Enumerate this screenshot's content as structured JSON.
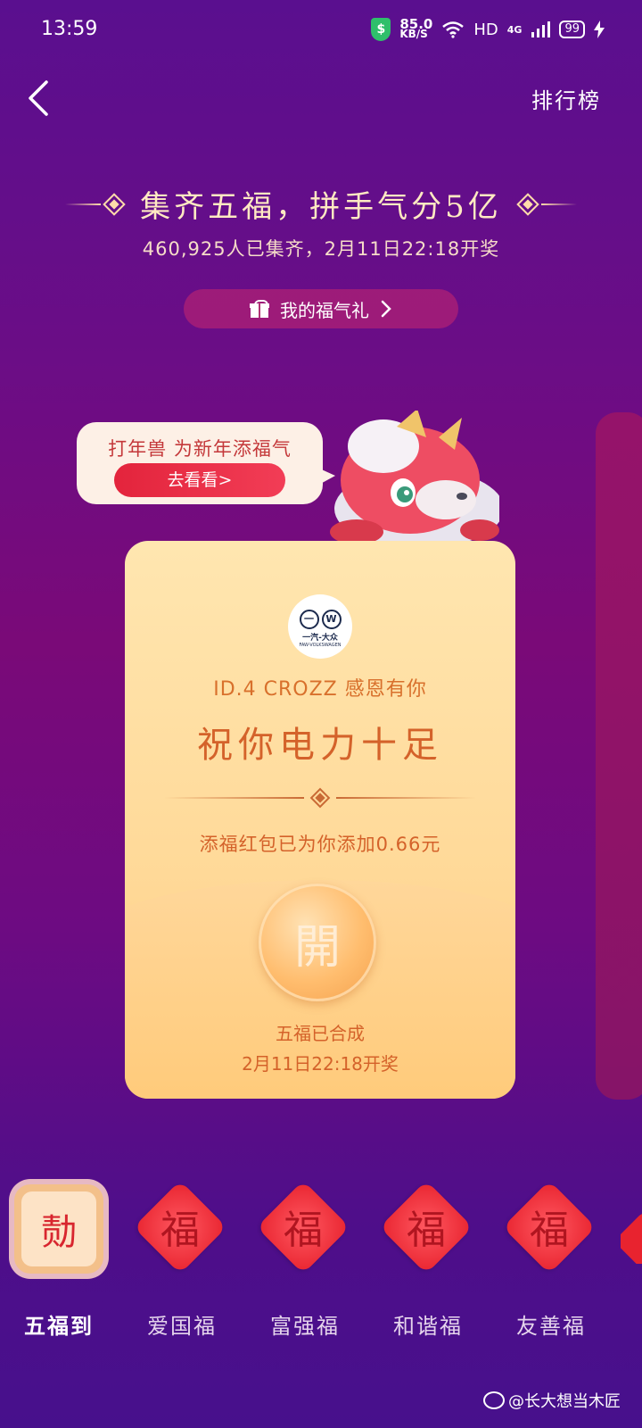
{
  "status_bar": {
    "time": "13:59",
    "speed_value": "85.0",
    "speed_unit": "KB/S",
    "hd": "HD",
    "network": "4G",
    "battery": "99"
  },
  "nav": {
    "back_icon": "chevron-left-icon",
    "ranking": "排行榜"
  },
  "header": {
    "title": "集齐五福，拼手气分5亿",
    "subtitle": "460,925人已集齐，2月11日22:18开奖",
    "gift_button": "我的福气礼"
  },
  "bubble": {
    "text": "打年兽 为新年添福气",
    "button": "去看看>"
  },
  "card": {
    "logo_mark": "一汽-大众",
    "logo_sub": "FAW-VOLKSWAGEN",
    "sponsor_line": "ID.4 CROZZ 感恩有你",
    "wish": "祝你电力十足",
    "bonus": "添福红包已为你添加0.66元",
    "open_label": "開",
    "status": "五福已合成",
    "draw_date": "2月11日22:18开奖"
  },
  "tabs": [
    {
      "label": "五福到",
      "glyph": "𪟝",
      "active": true
    },
    {
      "label": "爱国福",
      "glyph": "福",
      "active": false
    },
    {
      "label": "富强福",
      "glyph": "福",
      "active": false
    },
    {
      "label": "和谐福",
      "glyph": "福",
      "active": false
    },
    {
      "label": "友善福",
      "glyph": "福",
      "active": false
    }
  ],
  "watermark": "@长大想当木匠",
  "colors": {
    "accent_gold": "#ffe9c2",
    "card_text": "#d4622a",
    "fu_red": "#e8232f",
    "bubble_red": "#e3243c"
  }
}
